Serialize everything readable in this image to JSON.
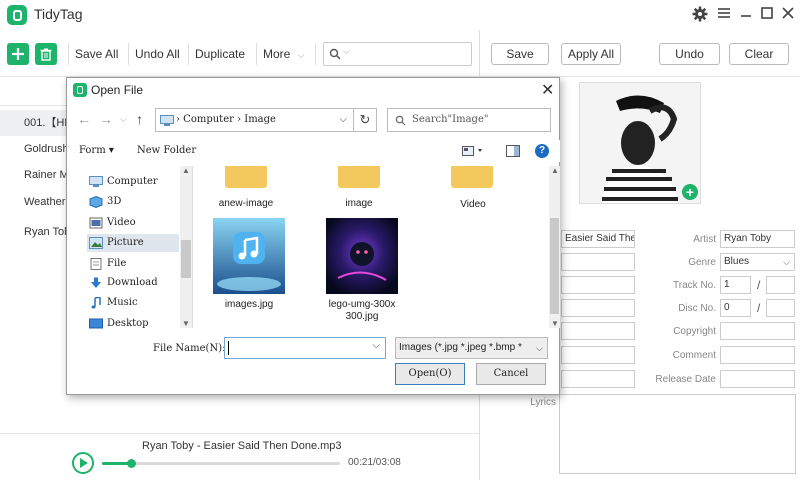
{
  "app": {
    "title": "TidyTag"
  },
  "toolbar": {
    "save_all": "Save All",
    "undo_all": "Undo All",
    "duplicate": "Duplicate",
    "more": "More"
  },
  "right_toolbar": {
    "save": "Save",
    "apply_all": "Apply All",
    "undo": "Undo",
    "clear": "Clear"
  },
  "file_list": {
    "rows": [
      "001.【HD",
      "Goldrush",
      "Rainer M",
      "Weather",
      "Ryan Tol"
    ]
  },
  "player": {
    "song": "Ryan Toby - Easier Said Then Done.mp3",
    "time": "00:21/03:08",
    "progress": 0.12
  },
  "tags": {
    "title_value": "Easier Said Ther",
    "artist_label": "Artist",
    "artist_value": "Ryan Toby",
    "genre_label": "Genre",
    "genre_value": "Blues",
    "track_label": "Track No.",
    "track_value": "1",
    "disc_label": "Disc No.",
    "disc_value": "0",
    "copyright_label": "Copyright",
    "comment_label": "Comment",
    "release_label": "Release Date",
    "lyrics_label": "Lyrics",
    "slash": "/"
  },
  "dialog": {
    "title": "Open File",
    "address": "› Computer › Image",
    "search_placeholder": "Search\"Image\"",
    "form_menu": "Form ▾",
    "new_folder": "New Folder",
    "nav_items": [
      "Computer",
      "3D",
      "Video",
      "Picture",
      "File",
      "Download",
      "Music",
      "Desktop"
    ],
    "folders": [
      "anew-image",
      "image",
      "Video"
    ],
    "files": [
      "images.jpg",
      "lego-umg-300x\n300.jpg"
    ],
    "file_name_label": "File Name(N):",
    "file_name_value": "",
    "file_type": "Images (*.jpg *.jpeg *.bmp *",
    "open_button": "Open(O)",
    "cancel_button": "Cancel"
  },
  "colors": {
    "accent": "#1db36a"
  }
}
